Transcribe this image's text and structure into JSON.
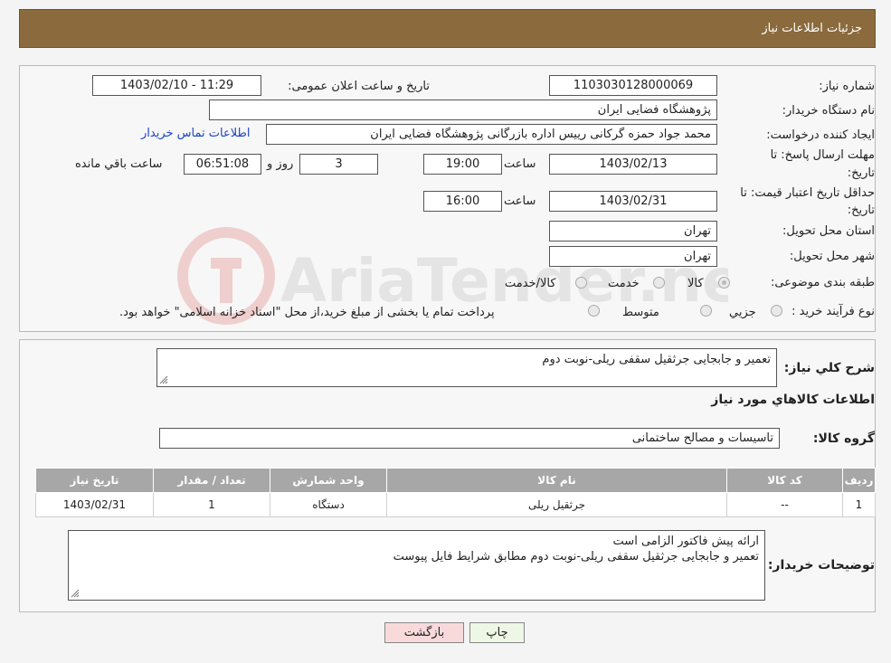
{
  "header": {
    "title": "جزئیات اطلاعات نیاز"
  },
  "form": {
    "need_number_label": "شماره نیاز:",
    "need_number": "1103030128000069",
    "announce_label": "تاریخ و ساعت اعلان عمومی:",
    "announce_value": "1403/02/10 - 11:29",
    "buyer_org_label": "نام دستگاه خریدار:",
    "buyer_org": "پژوهشگاه فضایی ایران",
    "creator_label": "ایجاد کننده درخواست:",
    "creator": "محمد جواد حمزه گرکانی رییس اداره بازرگانی پژوهشگاه فضایی ایران",
    "contact_link": "اطلاعات تماس خریدار",
    "deadline_label_1": "مهلت ارسال پاسخ: تا",
    "deadline_label_2": "تاریخ:",
    "deadline_date": "1403/02/13",
    "time_label": "ساعت",
    "deadline_time": "19:00",
    "days_value": "3",
    "days_label": "روز و",
    "remaining_value": "06:51:08",
    "remaining_label": "ساعت باقي مانده",
    "validity_label_1": "حداقل تاریخ اعتبار قیمت: تا",
    "validity_label_2": "تاریخ:",
    "validity_date": "1403/02/31",
    "validity_time": "16:00",
    "province_label": "استان محل تحویل:",
    "province": "تهران",
    "city_label": "شهر محل تحویل:",
    "city": "تهران",
    "category_label": "طبقه بندی موضوعی:",
    "category_options": [
      "کالا",
      "خدمت",
      "کالا/خدمت"
    ],
    "purchase_type_label": "نوع فرآیند خرید :",
    "purchase_options": [
      "جزیي",
      "متوسط"
    ],
    "purchase_note": "پرداخت تمام یا بخشی از مبلغ خرید،از محل \"اسناد خزانه اسلامی\" خواهد بود."
  },
  "details": {
    "summary_label": "شرح كلي نياز:",
    "summary": "تعمیر و جابجایی جرثقیل سقفی ریلی-نوبت دوم",
    "goods_info_title": "اطلاعات كالاهاي مورد نياز",
    "goods_group_label": "گروه کالا:",
    "goods_group": "تاسیسات و مصالح ساختمانی",
    "table": {
      "headers": [
        "ردیف",
        "کد کالا",
        "نام کالا",
        "واحد شمارش",
        "تعداد / مقدار",
        "تاریخ نیاز"
      ],
      "rows": [
        [
          "1",
          "--",
          "جرثقیل ریلی",
          "دستگاه",
          "1",
          "1403/02/31"
        ]
      ]
    },
    "buyer_notes_label": "توضیحات خریدار:",
    "buyer_notes_line1": "ارائه پیش فاکتور الزامی است",
    "buyer_notes_line2": "تعمیر و جابجایی جرثقیل سقفی ریلی-نوبت دوم مطابق شرایط فایل پیوست"
  },
  "buttons": {
    "print": "چاپ",
    "back": "بازگشت"
  },
  "watermark": {
    "text": "AriaTender.neT"
  },
  "colors": {
    "header": "#8b6a3d",
    "link": "#1a44c8",
    "back_button": "#f9dada",
    "print_button": "#eef7e6"
  }
}
